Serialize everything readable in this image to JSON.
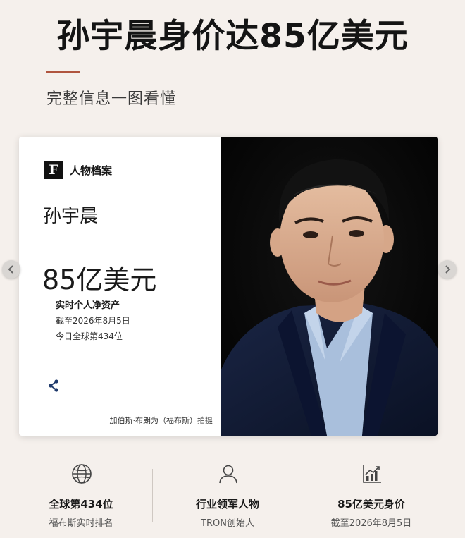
{
  "headline": "孙宇晨身价达85亿美元",
  "subheadline": "完整信息一图看懂",
  "colors": {
    "accent": "#b0553f",
    "background": "#f5f0ec",
    "card": "#ffffff",
    "photo_background": "#050505",
    "suit": "#101a33",
    "shirt": "#a9bfdc"
  },
  "profile_card": {
    "logo_letter": "F",
    "section_label": "人物档案",
    "person_name": "孙宇晨",
    "net_worth": "85亿美元",
    "net_worth_label": "实时个人净资产",
    "as_of": "截至2026年8月5日",
    "rank_today": "今日全球第434位",
    "share_icon": "share-icon",
    "photo_credit": "加伯斯·布朗为（福布斯）拍摄",
    "photo": "portrait-photo"
  },
  "carousel": {
    "prev_icon": "chevron-left-icon",
    "next_icon": "chevron-right-icon"
  },
  "stats": [
    {
      "icon": "globe-icon",
      "title": "全球第434位",
      "subtitle": "福布斯实时排名"
    },
    {
      "icon": "user-icon",
      "title": "行业领军人物",
      "subtitle": "TRON创始人"
    },
    {
      "icon": "growth-chart-icon",
      "title": "85亿美元身价",
      "subtitle": "截至2026年8月5日"
    }
  ]
}
